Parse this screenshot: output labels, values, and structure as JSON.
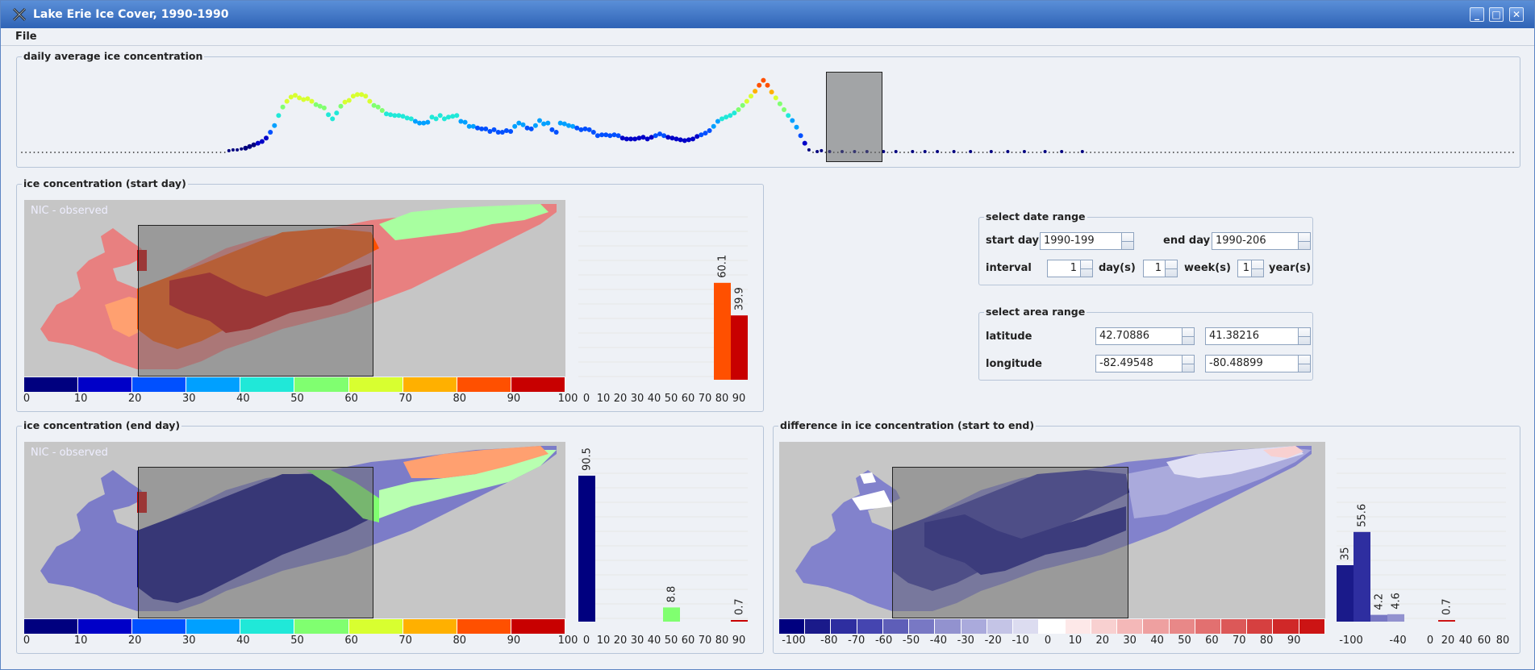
{
  "window": {
    "title": "Lake Erie Ice Cover, 1990-1990"
  },
  "menu": {
    "file": "File"
  },
  "timeline": {
    "title": "daily average ice concentration",
    "colors": [
      "#00007f",
      "#0000c8",
      "#0050ff",
      "#00a0ff",
      "#20e8d8",
      "#80ff70",
      "#d8ff30",
      "#ffb000",
      "#ff5000",
      "#c80000"
    ],
    "values": [
      0,
      0,
      0,
      0,
      0,
      0,
      0,
      0,
      0,
      0,
      0,
      0,
      0,
      0,
      0,
      0,
      0,
      0,
      0,
      0,
      0,
      0,
      0,
      0,
      0,
      0,
      0,
      0,
      0,
      0,
      0,
      0,
      0,
      0,
      0,
      0,
      0,
      0,
      0,
      0,
      0,
      0,
      0,
      0,
      0,
      0,
      0,
      0,
      0,
      0,
      2,
      3,
      3,
      4,
      5,
      7,
      9,
      11,
      13,
      17,
      24,
      32,
      44,
      54,
      61,
      66,
      68,
      65,
      63,
      64,
      61,
      57,
      55,
      53,
      45,
      40,
      47,
      55,
      60,
      62,
      67,
      69,
      69,
      67,
      61,
      56,
      54,
      50,
      46,
      45,
      44,
      44,
      43,
      41,
      40,
      37,
      35,
      35,
      36,
      42,
      40,
      44,
      40,
      42,
      43,
      44,
      37,
      36,
      31,
      31,
      29,
      28,
      28,
      25,
      27,
      24,
      24,
      26,
      25,
      31,
      35,
      33,
      29,
      28,
      32,
      38,
      34,
      35,
      27,
      24,
      35,
      34,
      32,
      31,
      29,
      27,
      28,
      27,
      24,
      20,
      21,
      21,
      20,
      21,
      20,
      17,
      16,
      16,
      16,
      17,
      18,
      16,
      18,
      20,
      22,
      20,
      18,
      17,
      16,
      15,
      14,
      15,
      16,
      19,
      21,
      23,
      26,
      31,
      37,
      40,
      42,
      44,
      47,
      51,
      56,
      61,
      67,
      73,
      80,
      86,
      80,
      72,
      65,
      58,
      51,
      44,
      38,
      30,
      20,
      11,
      3,
      0,
      1,
      2,
      0,
      1,
      0,
      0,
      1,
      0,
      0,
      1,
      0,
      0,
      1,
      0,
      0,
      0,
      1,
      0,
      0,
      1,
      0,
      0,
      0,
      1,
      0,
      0,
      1,
      0,
      0,
      1,
      0,
      0,
      0,
      1,
      0,
      0,
      0,
      1,
      0,
      0,
      0,
      0,
      1,
      0,
      0,
      0,
      1,
      0,
      0,
      0,
      1,
      0,
      0,
      0,
      0,
      1,
      0,
      0,
      0,
      1,
      0,
      0,
      0,
      0,
      1,
      0,
      0,
      0,
      0,
      0,
      0,
      0,
      0,
      0,
      0,
      0,
      0,
      0,
      0,
      0,
      0,
      0,
      0,
      0,
      0,
      0,
      0,
      0,
      0,
      0,
      0,
      0,
      0,
      0,
      0,
      0,
      0,
      0,
      0,
      0,
      0,
      0,
      0,
      0,
      0,
      0,
      0,
      0,
      0,
      0,
      0,
      0,
      0,
      0,
      0,
      0,
      0,
      0,
      0,
      0,
      0,
      0,
      0,
      0,
      0,
      0,
      0,
      0,
      0,
      0,
      0,
      0,
      0,
      0,
      0,
      0,
      0,
      0,
      0,
      0,
      0,
      0,
      0,
      0,
      0,
      0,
      0,
      0,
      0,
      0,
      0,
      0,
      0,
      0,
      0,
      0,
      0,
      0,
      0,
      0,
      0,
      0,
      0,
      0,
      0,
      0,
      0,
      0,
      0
    ]
  },
  "start_panel": {
    "title": "ice concentration (start day)",
    "overlay": "NIC - observed",
    "legend_ticks": [
      "0",
      "10",
      "20",
      "30",
      "40",
      "50",
      "60",
      "70",
      "80",
      "90",
      "100"
    ],
    "hist_ticks": [
      "0",
      "10",
      "20",
      "30",
      "40",
      "50",
      "60",
      "70",
      "80",
      "90"
    ],
    "hist_labels": {
      "80": "60.1",
      "90": "39.9"
    }
  },
  "end_panel": {
    "title": "ice concentration (end day)",
    "overlay": "NIC - observed",
    "legend_ticks": [
      "0",
      "10",
      "20",
      "30",
      "40",
      "50",
      "60",
      "70",
      "80",
      "90",
      "100"
    ],
    "hist_ticks": [
      "0",
      "10",
      "20",
      "30",
      "40",
      "50",
      "60",
      "70",
      "80",
      "90"
    ],
    "hist_labels": {
      "0": "90.5",
      "50": "8.8",
      "90": "0.7"
    }
  },
  "diff_panel": {
    "title": "difference in ice concentration (start to end)",
    "colors": [
      "#00007f",
      "#1a1a8a",
      "#2e2ea0",
      "#4545b0",
      "#5e5eb8",
      "#7878c4",
      "#9292cf",
      "#aaaadc",
      "#c4c4e6",
      "#dcdcf0",
      "#ffffff",
      "#fde8e8",
      "#f8d0d0",
      "#f4b8b8",
      "#eea0a0",
      "#e88888",
      "#e27070",
      "#dc5858",
      "#d64040",
      "#d02828",
      "#cc1414"
    ],
    "legend_ticks": [
      "-100",
      "-80",
      "-70",
      "-60",
      "-50",
      "-40",
      "-30",
      "-20",
      "-10",
      "0",
      "10",
      "20",
      "30",
      "40",
      "50",
      "60",
      "70",
      "80",
      "90"
    ],
    "hist_ticks": [
      "-100",
      "-40",
      "0",
      "20",
      "40",
      "60",
      "80"
    ],
    "hist_labels": {
      "-100": "35",
      "-90": "55.6",
      "-80": "4.2",
      "-70": "4.6",
      "-40": "0.7"
    }
  },
  "date_range": {
    "title": "select date range",
    "start_label": "start day",
    "start_value": "1990-199",
    "end_label": "end day",
    "end_value": "1990-206",
    "interval_label": "interval",
    "day_value": "1",
    "day_unit": "day(s)",
    "week_value": "1",
    "week_unit": "week(s)",
    "year_value": "1",
    "year_unit": "year(s)"
  },
  "area_range": {
    "title": "select area range",
    "lat_label": "latitude",
    "lat_min": "42.70886",
    "lat_max": "41.38216",
    "lon_label": "longitude",
    "lon_min": "-82.49548",
    "lon_max": "-80.48899"
  }
}
